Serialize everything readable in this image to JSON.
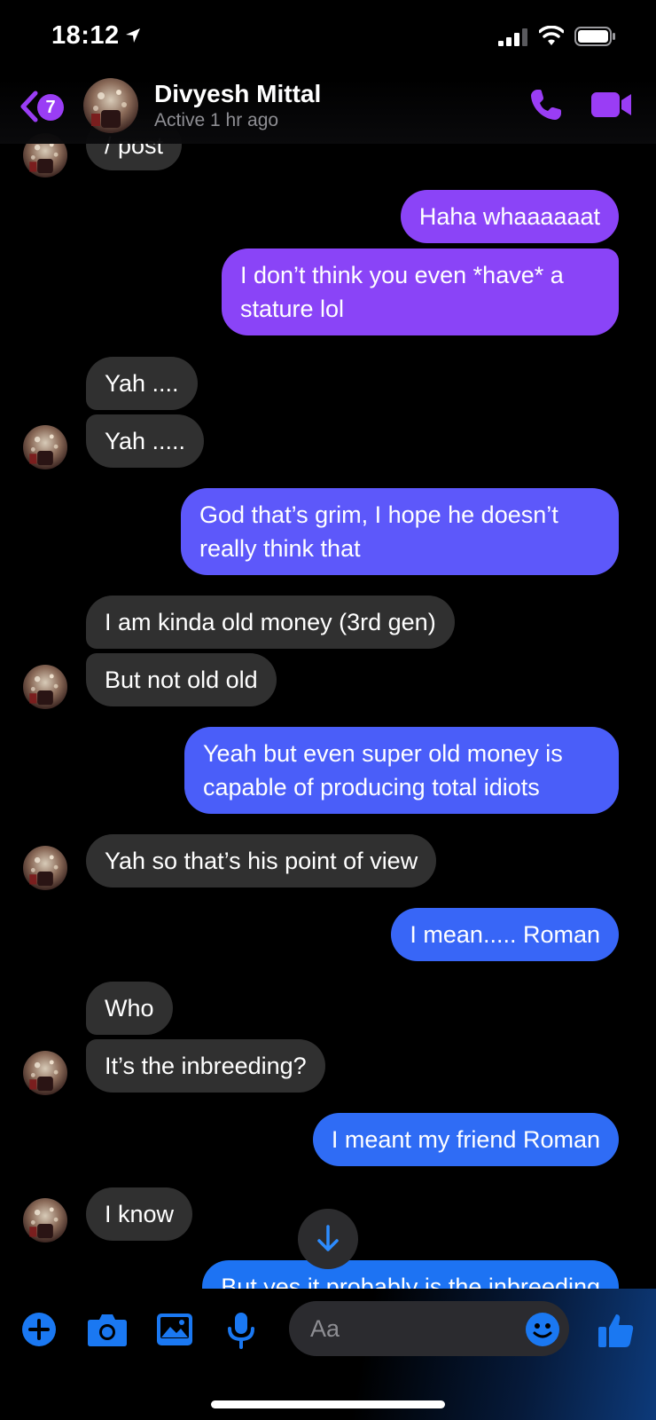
{
  "status_bar": {
    "time": "18:12"
  },
  "header": {
    "back_badge_count": "7",
    "contact_name": "Divyesh Mittal",
    "contact_status": "Active 1 hr ago"
  },
  "messages": [
    {
      "from": "them",
      "text": "/ post"
    },
    {
      "from": "me",
      "text": "Haha whaaaaaat"
    },
    {
      "from": "me",
      "text": "I don’t think you even *have* a stature lol"
    },
    {
      "from": "them",
      "text": "Yah ...."
    },
    {
      "from": "them",
      "text": "Yah ....."
    },
    {
      "from": "me",
      "text": "God that’s grim, I hope he doesn’t really think that"
    },
    {
      "from": "them",
      "text": "I am kinda old money (3rd gen)"
    },
    {
      "from": "them",
      "text": "But not old old"
    },
    {
      "from": "me",
      "text": "Yeah but even super old money is capable of producing total idiots"
    },
    {
      "from": "them",
      "text": "Yah so that’s his point of view"
    },
    {
      "from": "me",
      "text": "I mean..... Roman"
    },
    {
      "from": "them",
      "text": "Who"
    },
    {
      "from": "them",
      "text": "It’s the inbreeding?"
    },
    {
      "from": "me",
      "text": "I meant my friend Roman"
    },
    {
      "from": "them",
      "text": "I know"
    },
    {
      "from": "me",
      "text": "But yes it probably is the inbreeding"
    }
  ],
  "composer": {
    "placeholder": "Aa"
  },
  "colors": {
    "accent": "#9a3df5",
    "incoming_bubble": "#303030",
    "outgoing_gradient": [
      "#8b44f7",
      "#7a4cf9",
      "#5d58fa",
      "#4a5ef9",
      "#2f6cf5",
      "#1d73f3"
    ],
    "composer_icon": "#1a78f2"
  },
  "icons": [
    "location-arrow-icon",
    "signal-icon",
    "wifi-icon",
    "battery-icon",
    "back-chevron-icon",
    "phone-icon",
    "video-camera-icon",
    "arrow-down-icon",
    "plus-icon",
    "camera-icon",
    "gallery-icon",
    "microphone-icon",
    "emoji-icon",
    "thumbs-up-icon"
  ]
}
